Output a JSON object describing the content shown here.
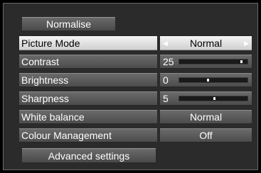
{
  "normalise_label": "Normalise",
  "advanced_label": "Advanced settings",
  "rows": [
    {
      "label": "Picture Mode",
      "value": "Normal",
      "left_arrow": "◀",
      "right_arrow": "▶"
    },
    {
      "label": "Contrast",
      "number": "25",
      "level": 0.92
    },
    {
      "label": "Brightness",
      "number": "0",
      "level": 0.42
    },
    {
      "label": "Sharpness",
      "number": "5",
      "level": 0.52
    },
    {
      "label": "White balance",
      "value": "Normal"
    },
    {
      "label": "Colour Management",
      "value": "Off"
    }
  ]
}
